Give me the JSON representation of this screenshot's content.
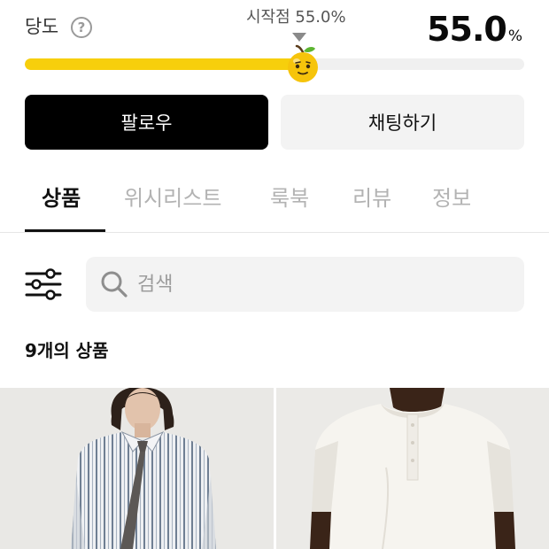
{
  "sweetness": {
    "label": "당도",
    "start_point_label": "시작점 55.0%",
    "value": "55.0",
    "unit": "%",
    "fill_percent": 55.0,
    "bar_color": "#f7cf0c"
  },
  "actions": {
    "follow_label": "팔로우",
    "chat_label": "채팅하기"
  },
  "tabs": [
    {
      "label": "상품",
      "active": true
    },
    {
      "label": "위시리스트",
      "active": false
    },
    {
      "label": "룩북",
      "active": false
    },
    {
      "label": "리뷰",
      "active": false
    },
    {
      "label": "정보",
      "active": false
    }
  ],
  "search": {
    "placeholder": "검색",
    "value": ""
  },
  "product_count_label": "9개의 상품",
  "products": [
    {
      "image": "striped-shirt-with-tie-photo"
    },
    {
      "image": "white-henley-tshirt-photo"
    }
  ],
  "icons": {
    "help": "help-circle-icon",
    "filter": "filter-sliders-icon",
    "search": "search-icon",
    "marker": "apple-face-icon"
  }
}
